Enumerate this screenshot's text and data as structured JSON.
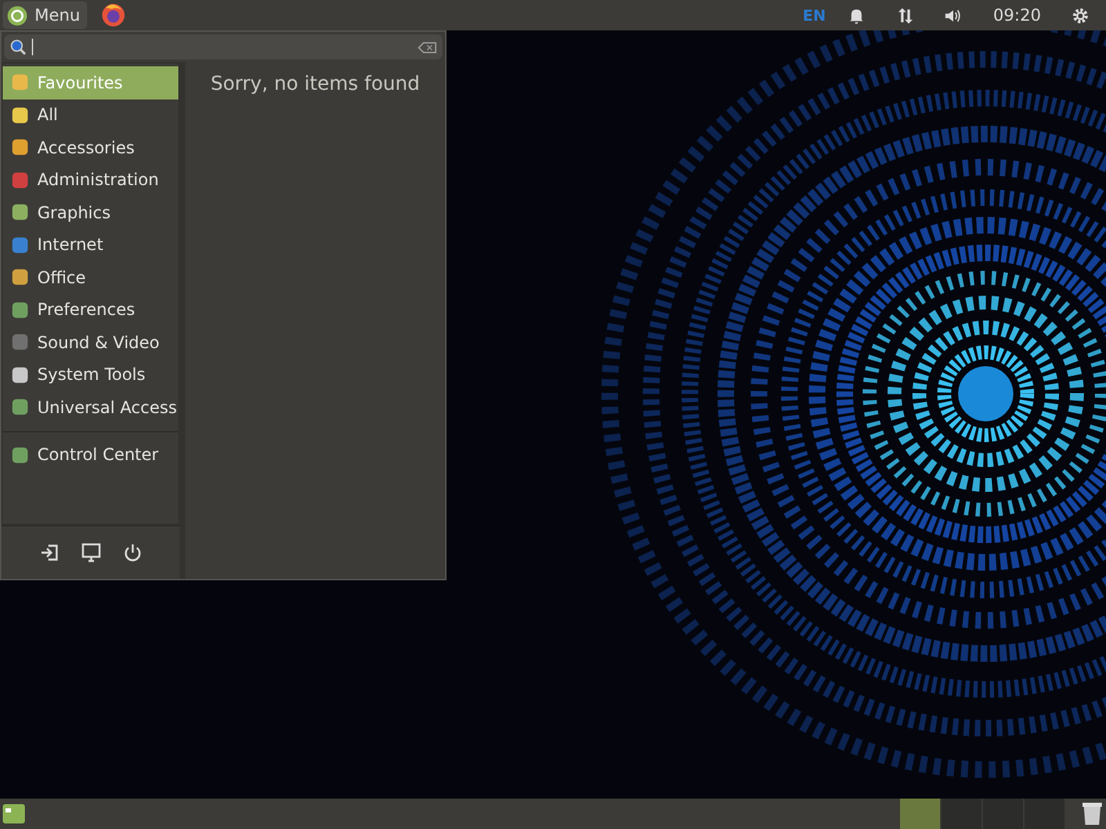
{
  "top_panel": {
    "menu_button": "Menu",
    "keyboard_layout": "EN",
    "clock": "09:20"
  },
  "app_menu": {
    "categories": [
      {
        "label": "Favourites",
        "selected": true
      },
      {
        "label": "All",
        "selected": false
      },
      {
        "label": "Accessories",
        "selected": false
      },
      {
        "label": "Administration",
        "selected": false
      },
      {
        "label": "Graphics",
        "selected": false
      },
      {
        "label": "Internet",
        "selected": false
      },
      {
        "label": "Office",
        "selected": false
      },
      {
        "label": "Preferences",
        "selected": false
      },
      {
        "label": "Sound & Video",
        "selected": false
      },
      {
        "label": "System Tools",
        "selected": false
      },
      {
        "label": "Universal Access",
        "selected": false
      }
    ],
    "places": [
      {
        "label": "Control Center",
        "selected": false
      }
    ],
    "message": "Sorry, no items found"
  },
  "bottom_panel": {
    "workspaces": [
      {
        "selected": true
      },
      {
        "selected": false
      },
      {
        "selected": false
      },
      {
        "selected": false
      }
    ]
  }
}
